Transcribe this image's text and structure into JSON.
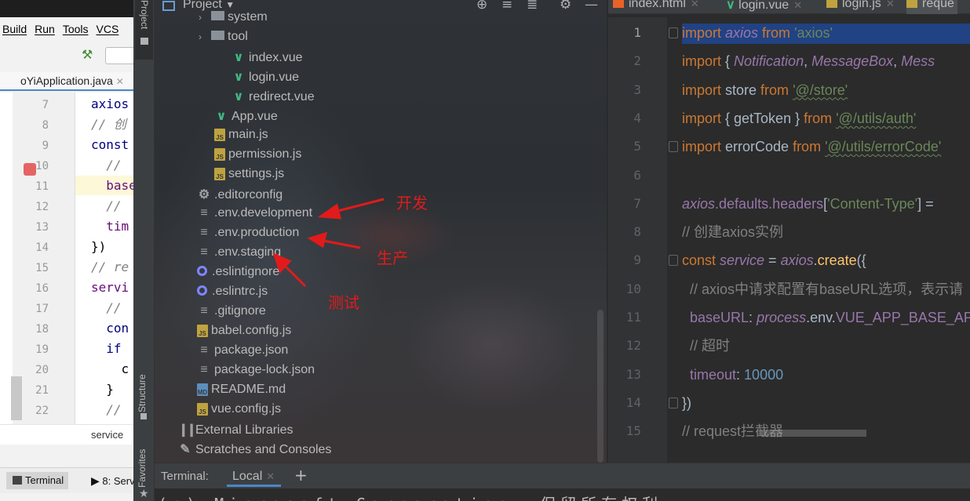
{
  "bg_ide": {
    "menu": [
      "Build",
      "Run",
      "Tools",
      "VCS"
    ],
    "file_tab": "oYiApplication.java",
    "lines": [
      {
        "num": "7",
        "code": "axios",
        "cls": "c-kw"
      },
      {
        "num": "8",
        "code": "// 创",
        "cls": "c-cm"
      },
      {
        "num": "9",
        "code": "const",
        "cls": "c-kw"
      },
      {
        "num": "10",
        "code": "  //",
        "cls": "c-cm"
      },
      {
        "num": "11",
        "code": "  base",
        "cls": "c-pu"
      },
      {
        "num": "12",
        "code": "  //",
        "cls": "c-cm"
      },
      {
        "num": "13",
        "code": "  tim",
        "cls": "c-pu"
      },
      {
        "num": "14",
        "code": "})",
        "cls": "c-pl"
      },
      {
        "num": "15",
        "code": "// re",
        "cls": "c-cm"
      },
      {
        "num": "16",
        "code": "servi",
        "cls": "c-pu"
      },
      {
        "num": "17",
        "code": "  //",
        "cls": "c-cm"
      },
      {
        "num": "18",
        "code": "  con",
        "cls": "c-kw"
      },
      {
        "num": "19",
        "code": "  if",
        "cls": "c-kw"
      },
      {
        "num": "20",
        "code": "    c",
        "cls": "c-pl"
      },
      {
        "num": "21",
        "code": "  }",
        "cls": "c-pl"
      },
      {
        "num": "22",
        "code": "  //",
        "cls": "c-cm"
      }
    ],
    "breadcrumb": "service",
    "terminal_tab": "Terminal",
    "services_tab": "8: Serv"
  },
  "stripe": {
    "project": "Project",
    "structure": "Structure",
    "favorites": "Favorites"
  },
  "project": {
    "title": "Project",
    "tree": [
      {
        "label": "system",
        "icon": "folder",
        "indent": 2,
        "arrow": true
      },
      {
        "label": "tool",
        "icon": "folder",
        "indent": 2,
        "arrow": true
      },
      {
        "label": "index.vue",
        "icon": "vue",
        "indent": 3
      },
      {
        "label": "login.vue",
        "icon": "vue",
        "indent": 3
      },
      {
        "label": "redirect.vue",
        "icon": "vue",
        "indent": 3
      },
      {
        "label": "App.vue",
        "icon": "vue",
        "indent": 2
      },
      {
        "label": "main.js",
        "icon": "js",
        "indent": 2
      },
      {
        "label": "permission.js",
        "icon": "js",
        "indent": 2
      },
      {
        "label": "settings.js",
        "icon": "js",
        "indent": 2
      },
      {
        "label": ".editorconfig",
        "icon": "gear",
        "indent": 1
      },
      {
        "label": ".env.development",
        "icon": "file",
        "indent": 1
      },
      {
        "label": ".env.production",
        "icon": "file",
        "indent": 1
      },
      {
        "label": ".env.staging",
        "icon": "file",
        "indent": 1
      },
      {
        "label": ".eslintignore",
        "icon": "circle",
        "indent": 1
      },
      {
        "label": ".eslintrc.js",
        "icon": "circle",
        "indent": 1
      },
      {
        "label": ".gitignore",
        "icon": "file",
        "indent": 1
      },
      {
        "label": "babel.config.js",
        "icon": "js",
        "indent": 1
      },
      {
        "label": "package.json",
        "icon": "file",
        "indent": 1
      },
      {
        "label": "package-lock.json",
        "icon": "file",
        "indent": 1
      },
      {
        "label": "README.md",
        "icon": "md",
        "indent": 1
      },
      {
        "label": "vue.config.js",
        "icon": "js",
        "indent": 1
      },
      {
        "label": "External Libraries",
        "icon": "lib",
        "indent": 0
      },
      {
        "label": "Scratches and Consoles",
        "icon": "scratch",
        "indent": 0
      }
    ]
  },
  "annotations": {
    "dev": "开发",
    "prod": "生产",
    "test": "测试",
    "color": "#e11b1b"
  },
  "editor": {
    "tabs": [
      {
        "label": "index.html",
        "icon": "html-icon"
      },
      {
        "label": "login.vue",
        "icon": "vue-icon"
      },
      {
        "label": "login.js",
        "icon": "js-icon"
      },
      {
        "label": "reque",
        "icon": "js-icon"
      }
    ],
    "lines": [
      {
        "num": "1",
        "tokens": [
          [
            "kw",
            "import "
          ],
          [
            "id",
            "axios"
          ],
          [
            "kw",
            " from "
          ],
          [
            "str",
            "'axios'"
          ]
        ]
      },
      {
        "num": "2",
        "tokens": [
          [
            "kw",
            "import "
          ],
          [
            "pl",
            "{ "
          ],
          [
            "id",
            "Notification"
          ],
          [
            "pl",
            ", "
          ],
          [
            "id",
            "MessageBox"
          ],
          [
            "pl",
            ", "
          ],
          [
            "id",
            "Mess"
          ]
        ]
      },
      {
        "num": "3",
        "tokens": [
          [
            "kw",
            "import "
          ],
          [
            "pl",
            "store "
          ],
          [
            "kw",
            "from "
          ],
          [
            "stru",
            "'@/store'"
          ]
        ]
      },
      {
        "num": "4",
        "tokens": [
          [
            "kw",
            "import "
          ],
          [
            "pl",
            "{ getToken } "
          ],
          [
            "kw",
            "from "
          ],
          [
            "stru",
            "'@/utils/auth'"
          ]
        ]
      },
      {
        "num": "5",
        "tokens": [
          [
            "kw",
            "import "
          ],
          [
            "pl",
            "errorCode "
          ],
          [
            "kw",
            "from "
          ],
          [
            "stru",
            "'@/utils/errorCode'"
          ]
        ]
      },
      {
        "num": "6",
        "tokens": []
      },
      {
        "num": "7",
        "tokens": [
          [
            "id",
            "axios"
          ],
          [
            "prop",
            ".defaults.headers"
          ],
          [
            "pl",
            "["
          ],
          [
            "str",
            "'Content-Type'"
          ],
          [
            "pl",
            "] ="
          ]
        ]
      },
      {
        "num": "8",
        "tokens": [
          [
            "cm",
            "// 创建axios实例"
          ]
        ]
      },
      {
        "num": "9",
        "tokens": [
          [
            "kw",
            "const "
          ],
          [
            "idp",
            "service"
          ],
          [
            "pl",
            " = "
          ],
          [
            "id",
            "axios"
          ],
          [
            "pl",
            "."
          ],
          [
            "fn",
            "create"
          ],
          [
            "pl",
            "({"
          ]
        ]
      },
      {
        "num": "10",
        "tokens": [
          [
            "cm",
            "  // axios中请求配置有baseURL选项，表示请"
          ]
        ]
      },
      {
        "num": "11",
        "tokens": [
          [
            "prop",
            "  baseURL"
          ],
          [
            "pl",
            ": "
          ],
          [
            "id",
            "process"
          ],
          [
            "pl",
            ".env."
          ],
          [
            "prop",
            "VUE_APP_BASE_AP"
          ]
        ]
      },
      {
        "num": "12",
        "tokens": [
          [
            "cm",
            "  // 超时"
          ]
        ]
      },
      {
        "num": "13",
        "tokens": [
          [
            "prop",
            "  timeout"
          ],
          [
            "pl",
            ": "
          ],
          [
            "num",
            "10000"
          ]
        ]
      },
      {
        "num": "14",
        "tokens": [
          [
            "pl",
            "})"
          ]
        ]
      },
      {
        "num": "15",
        "tokens": [
          [
            "cm",
            "// request拦截器"
          ]
        ]
      }
    ]
  },
  "terminal": {
    "label": "Terminal:",
    "tab": "Local",
    "add": "+",
    "output": "(c) Microsoft Corporation. 保留所有权利。"
  }
}
